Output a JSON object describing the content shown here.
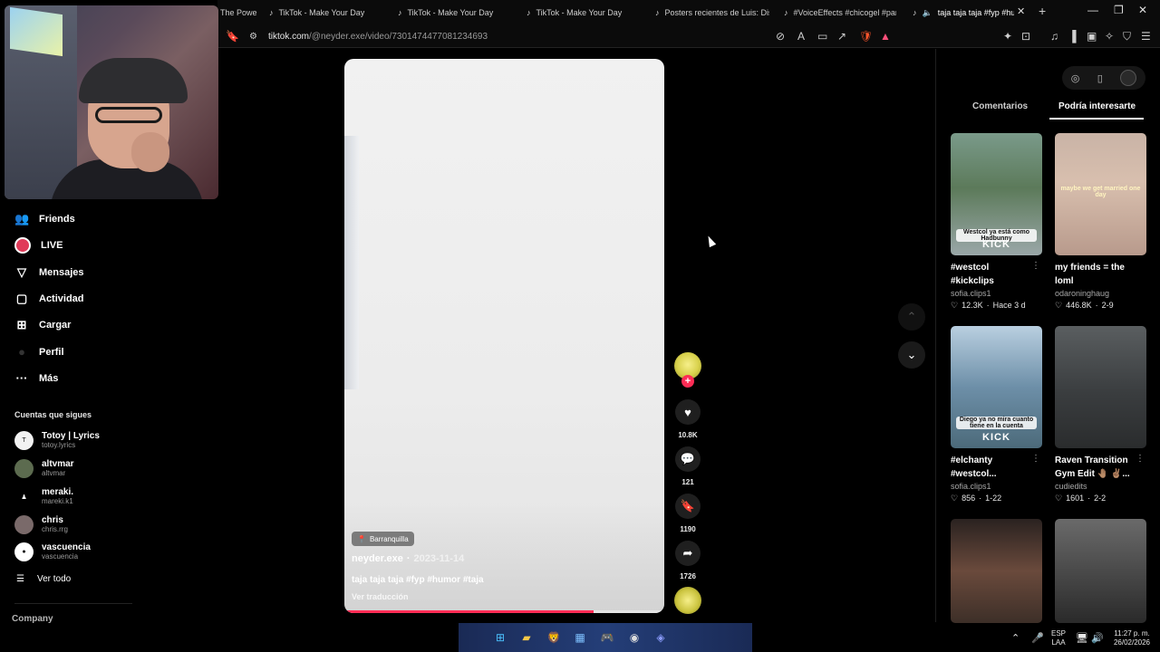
{
  "browser": {
    "tabs": [
      {
        "label": "The Powe",
        "active": false
      },
      {
        "label": "TikTok - Make Your Day",
        "active": false
      },
      {
        "label": "TikTok - Make Your Day",
        "active": false
      },
      {
        "label": "TikTok - Make Your Day",
        "active": false
      },
      {
        "label": "Posters recientes de Luis: Disef",
        "active": false
      },
      {
        "label": "#VoiceEffects #chicogel #paral",
        "active": false
      },
      {
        "label": "taja taja taja #fyp #hum",
        "active": true
      }
    ],
    "url_host": "tiktok.com",
    "url_path": "/@neyder.exe/video/7301474477081234693"
  },
  "sidebar": {
    "nav": [
      {
        "label": "Friends",
        "icon": "friends-icon"
      },
      {
        "label": "LIVE",
        "icon": "live-icon"
      },
      {
        "label": "Mensajes",
        "icon": "messages-icon"
      },
      {
        "label": "Actividad",
        "icon": "activity-icon"
      },
      {
        "label": "Cargar",
        "icon": "upload-icon"
      },
      {
        "label": "Perfil",
        "icon": "profile-icon"
      },
      {
        "label": "Más",
        "icon": "more-icon"
      }
    ],
    "following_title": "Cuentas que sigues",
    "accounts": [
      {
        "name": "Totoy | Lyrics",
        "handle": "totoy.lyrics",
        "color": "#f2f2f2"
      },
      {
        "name": "altvmar",
        "handle": "altvmar",
        "color": "#5c6b4f"
      },
      {
        "name": "meraki.",
        "handle": "mareki.k1",
        "color": "#2b2b2b"
      },
      {
        "name": "chris",
        "handle": "chris.rrg",
        "color": "#7a6a6a"
      },
      {
        "name": "vascuencia",
        "handle": "vascuencia",
        "color": "#111111"
      }
    ],
    "see_all": "Ver todo",
    "company": "Company"
  },
  "video": {
    "location": "Barranquilla",
    "author": "neyder.exe",
    "separator": "·",
    "date": "2023-11-14",
    "caption": "taja taja taja #fyp #humor #taja",
    "translate": "Ver traducción",
    "progress": 0.78
  },
  "actions": {
    "likes": "10.8K",
    "comments": "121",
    "saves": "1190",
    "shares": "1726"
  },
  "panel": {
    "tab_comments": "Comentarios",
    "tab_suggested": "Podría interesarte",
    "cards": [
      {
        "title": "#westcol #kickclips",
        "author": "sofia.clips1",
        "likes": "12.3K",
        "sep": "·",
        "date": "Hace 3 d",
        "overlay": "Westcol ya está como Hadbunny",
        "kick": "KICK",
        "bg": "#5c7a5a"
      },
      {
        "title": "my friends = the loml",
        "author": "odaroninghaug",
        "likes": "446.8K",
        "sep": "·",
        "date": "2-9",
        "overlay": "maybe we get married one day",
        "kick": "",
        "bg": "#b89a8c"
      },
      {
        "title": "#elchanty #westcol...",
        "author": "sofia.clips1",
        "likes": "856",
        "sep": "·",
        "date": "1-22",
        "overlay": "Diego ya no mira cuanto tiene en la cuenta",
        "kick": "KICK",
        "bg": "#6d8fa8"
      },
      {
        "title": "Raven Transition Gym Edit 🤚🏽 ✌🏽...",
        "author": "cudiedits",
        "likes": "1601",
        "sep": "·",
        "date": "2-2",
        "overlay": "",
        "kick": "",
        "bg": "#3a3d3f"
      },
      {
        "title": "",
        "author": "",
        "likes": "",
        "sep": "",
        "date": "",
        "overlay": "",
        "kick": "",
        "bg": "#3d2f28"
      },
      {
        "title": "",
        "author": "",
        "likes": "",
        "sep": "",
        "date": "",
        "overlay": "",
        "kick": "",
        "bg": "#4a4a4a"
      }
    ]
  },
  "taskbar": {
    "lang_top": "ESP",
    "lang_bottom": "LAA",
    "time": "11:27 p. m.",
    "date": "26/02/2026"
  },
  "colors": {
    "accent": "#fe2c55",
    "save_yellow": "#f5c518"
  }
}
